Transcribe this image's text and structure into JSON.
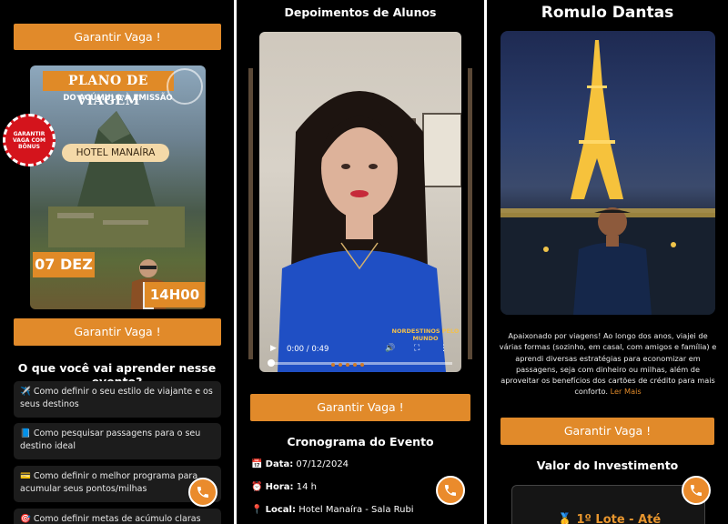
{
  "panel1": {
    "cta_top": "Garantir Vaga !",
    "poster": {
      "title": "PLANO DE VIAGEM",
      "subtitle": "DO ACÚMULO À EMISSÃO",
      "hotel": "HOTEL MANAÍRA",
      "date": "07 DEZ",
      "time": "14H00",
      "seal": "GARANTIR VAGA COM BÔNUS"
    },
    "cta_mid": "Garantir Vaga !",
    "learn_heading": "O que você vai aprender nesse evento?",
    "learn_items": [
      {
        "emoji": "✈️",
        "text": "Como definir o seu estilo de viajante e os seus destinos"
      },
      {
        "emoji": "📘",
        "text": "Como pesquisar passagens para o seu destino ideal"
      },
      {
        "emoji": "💳",
        "text": "Como definir o melhor programa para acumular seus pontos/milhas"
      },
      {
        "emoji": "🎯",
        "text": "Como definir metas de acúmulo claras para a"
      }
    ]
  },
  "panel2": {
    "heading": "Depoimentos de Alunos",
    "video": {
      "current_time": "0:00",
      "duration": "0:49",
      "time_display": "0:00 / 0:49",
      "watermark": "NORDESTINOS PELO MUNDO"
    },
    "carousel_dots": 5,
    "cta": "Garantir Vaga !",
    "schedule_heading": "Cronograma do Evento",
    "schedule": [
      {
        "icon": "📅",
        "label": "Data:",
        "value": "07/12/2024"
      },
      {
        "icon": "⏰",
        "label": "Hora:",
        "value": "14 h"
      },
      {
        "icon": "📍",
        "label": "Local:",
        "value": "Hotel Manaíra - Sala Rubi"
      }
    ]
  },
  "panel3": {
    "name": "Romulo Dantas",
    "bio": "Apaixonado por viagens! Ao longo dos anos, viajei de várias formas (sozinho, em casal, com amigos e família) e aprendi diversas estratégias para economizar em passagens, seja com dinheiro ou milhas, além de aproveitar os benefícios dos cartões de crédito para mais conforto.",
    "read_more": "Ler Mais",
    "cta": "Garantir Vaga !",
    "price_heading": "Valor do Investimento",
    "price_lot": "🥇 1º Lote - Até"
  },
  "colors": {
    "accent": "#e18a2a",
    "background": "#000000",
    "card": "#1c1c1c"
  },
  "icons": {
    "whatsapp_fab": "phone-icon"
  }
}
